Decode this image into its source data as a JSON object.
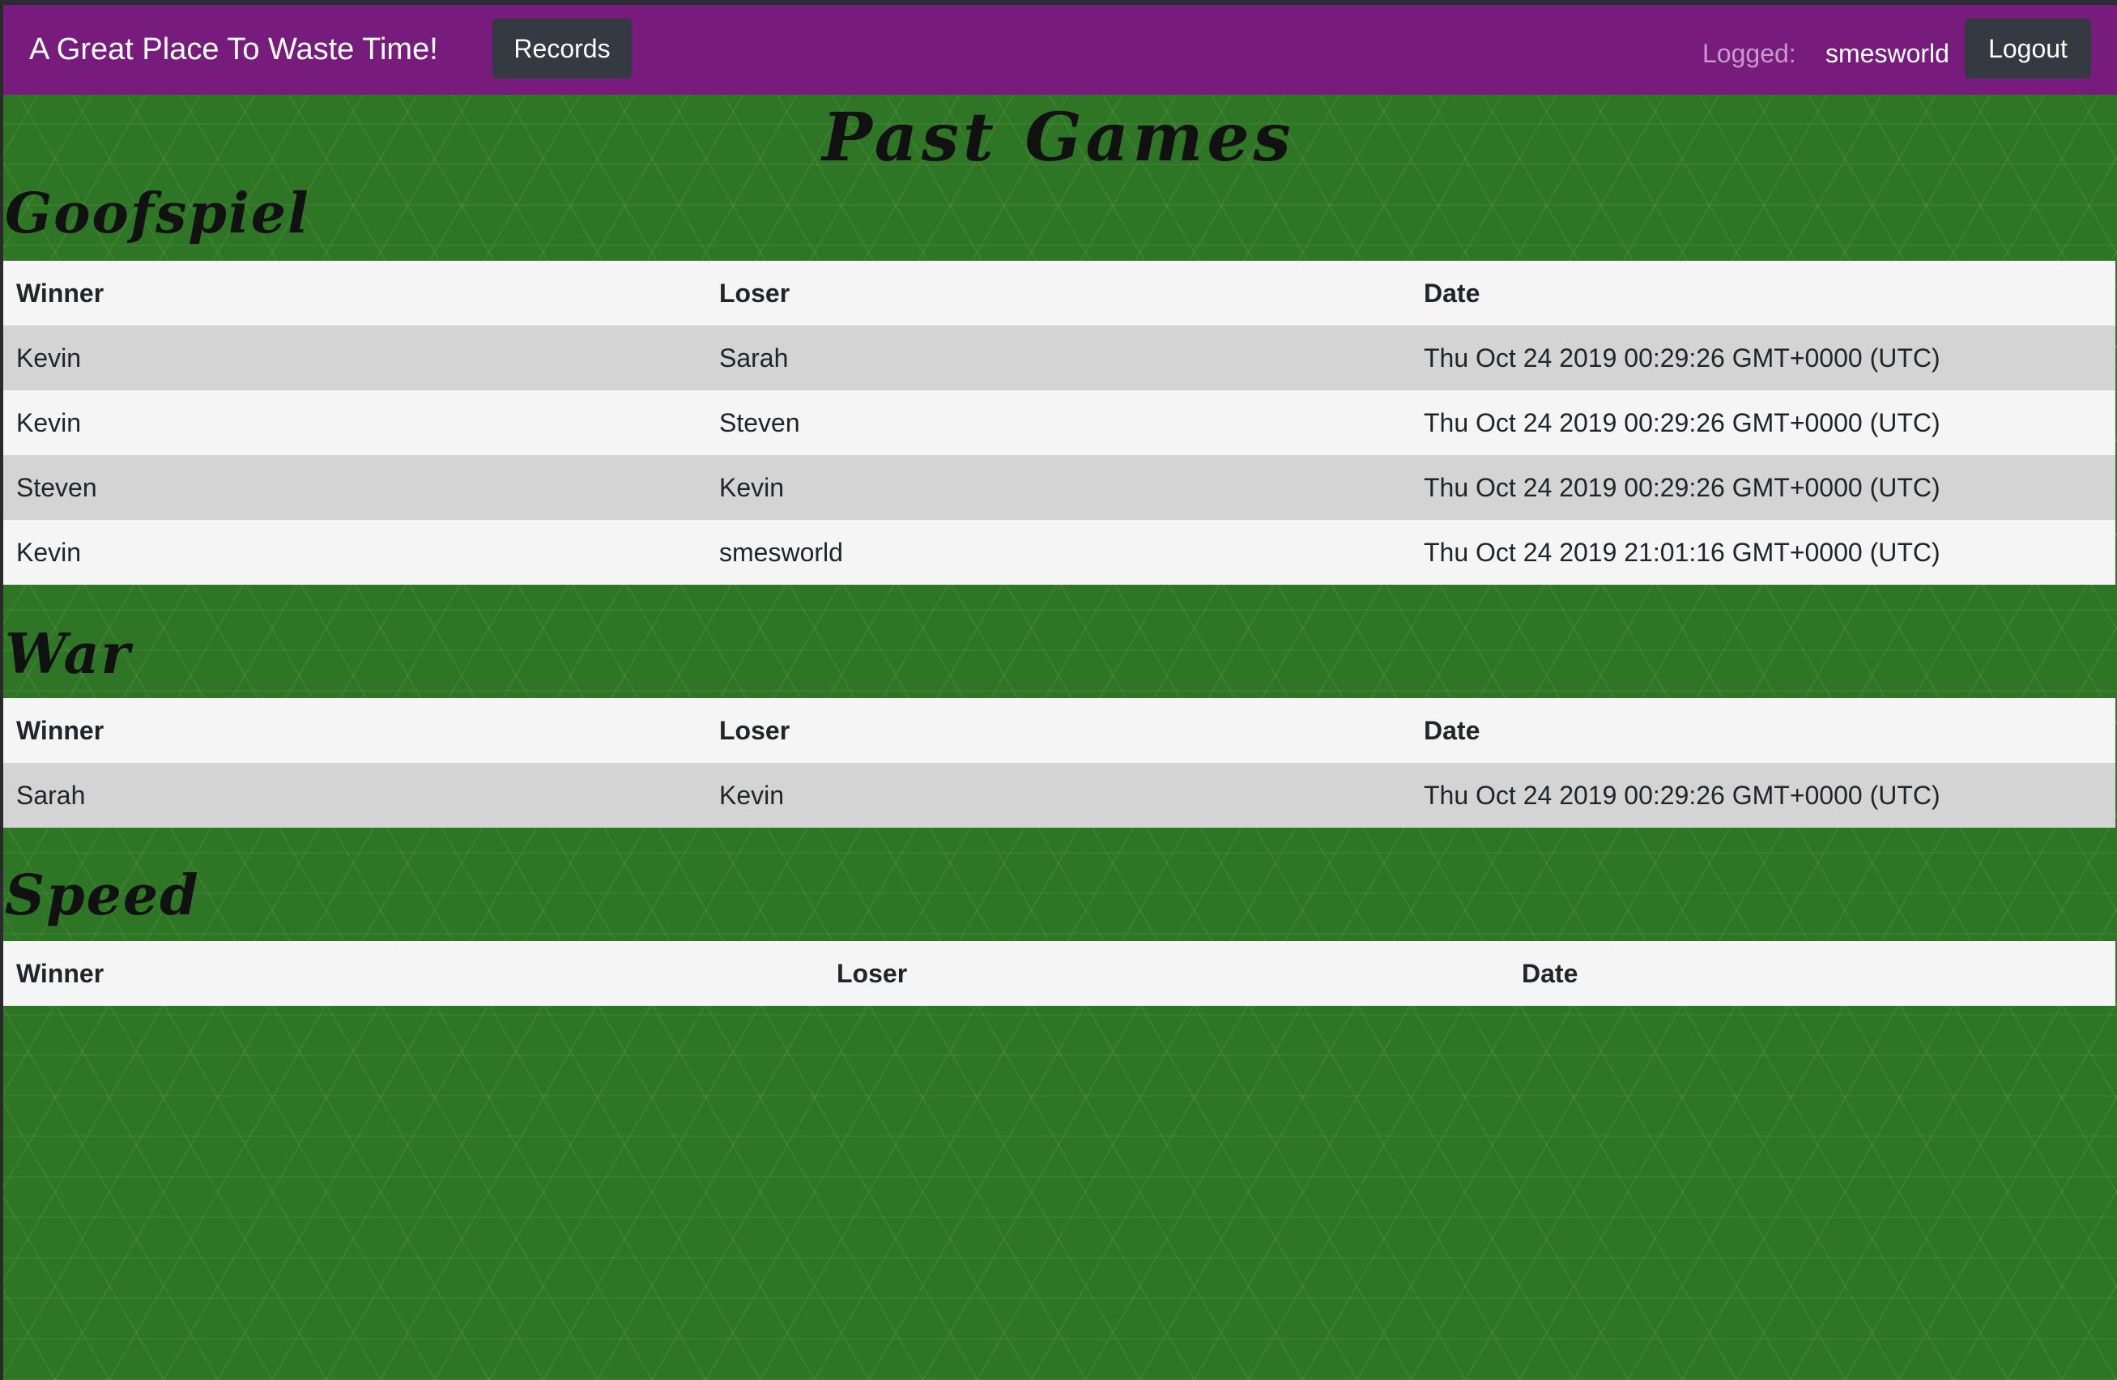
{
  "navbar": {
    "brand": "A Great Place To Waste Time!",
    "records_label": "Records",
    "logged_label": "Logged:",
    "username": "smesworld",
    "logout_label": "Logout"
  },
  "page": {
    "title": "Past Games"
  },
  "sections": [
    {
      "title": "Goofspiel",
      "headers": [
        "Winner",
        "Loser",
        "Date"
      ],
      "rows": [
        [
          "Kevin",
          "Sarah",
          "Thu Oct 24 2019 00:29:26 GMT+0000 (UTC)"
        ],
        [
          "Kevin",
          "Steven",
          "Thu Oct 24 2019 00:29:26 GMT+0000 (UTC)"
        ],
        [
          "Steven",
          "Kevin",
          "Thu Oct 24 2019 00:29:26 GMT+0000 (UTC)"
        ],
        [
          "Kevin",
          "smesworld",
          "Thu Oct 24 2019 21:01:16 GMT+0000 (UTC)"
        ]
      ]
    },
    {
      "title": "War",
      "headers": [
        "Winner",
        "Loser",
        "Date"
      ],
      "rows": [
        [
          "Sarah",
          "Kevin",
          "Thu Oct 24 2019 00:29:26 GMT+0000 (UTC)"
        ]
      ]
    },
    {
      "title": "Speed",
      "headers": [
        "Winner",
        "Loser",
        "Date"
      ],
      "rows": []
    }
  ]
}
